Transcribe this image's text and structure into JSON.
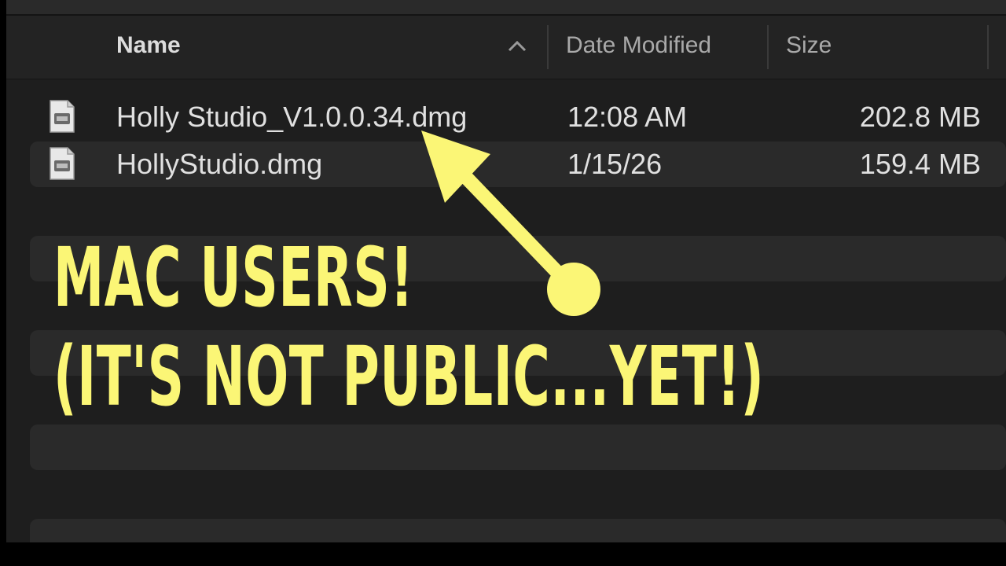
{
  "columns": {
    "name": "Name",
    "date_modified": "Date Modified",
    "size": "Size"
  },
  "files": [
    {
      "name": "Holly Studio_V1.0.0.34.dmg",
      "date": "12:08 AM",
      "size": "202.8 MB",
      "icon": "disk-image-icon"
    },
    {
      "name": "HollyStudio.dmg",
      "date": "1/15/26",
      "size": "159.4 MB",
      "icon": "disk-image-icon"
    }
  ],
  "overlay": {
    "line1": "MAC USERS!",
    "line2": "(IT'S NOT PUBLIC...YET!)",
    "color": "#fbf676"
  },
  "icons": {
    "sort": "chevron-up-icon",
    "pointer": "arrow-icon"
  }
}
